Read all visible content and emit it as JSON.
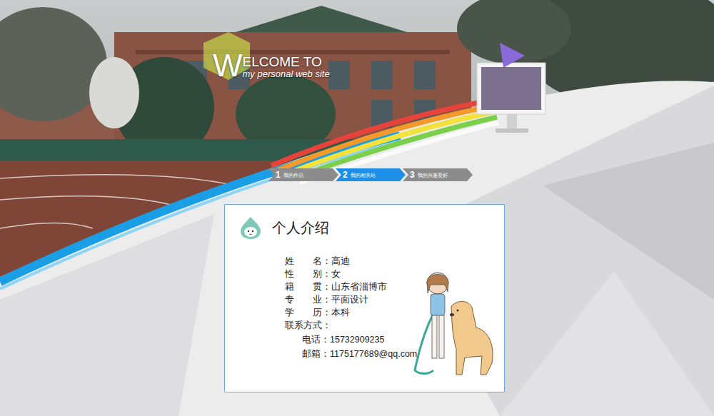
{
  "header": {
    "logo_initial": "W",
    "logo_line1": "ELCOME TO",
    "logo_line2": "my personal web site"
  },
  "steps": [
    {
      "number": "1",
      "label": "我的作品",
      "selected": false
    },
    {
      "number": "2",
      "label": "我的相关站",
      "selected": true
    },
    {
      "number": "3",
      "label": "我的兴趣爱好",
      "selected": false
    }
  ],
  "card": {
    "title": "个人介绍",
    "fields": [
      {
        "label": "姓　　名：",
        "value": "高迪"
      },
      {
        "label": "性　　别：",
        "value": "女"
      },
      {
        "label": "籍　　贯：",
        "value": "山东省淄博市"
      },
      {
        "label": "专　　业：",
        "value": "平面设计"
      },
      {
        "label": "学　　历：",
        "value": "本科"
      }
    ],
    "contact_heading": "联系方式：",
    "contacts": [
      {
        "label": "电话：",
        "value": "15732909235"
      },
      {
        "label": "邮箱：",
        "value": "1175177689@qq.com"
      }
    ]
  }
}
